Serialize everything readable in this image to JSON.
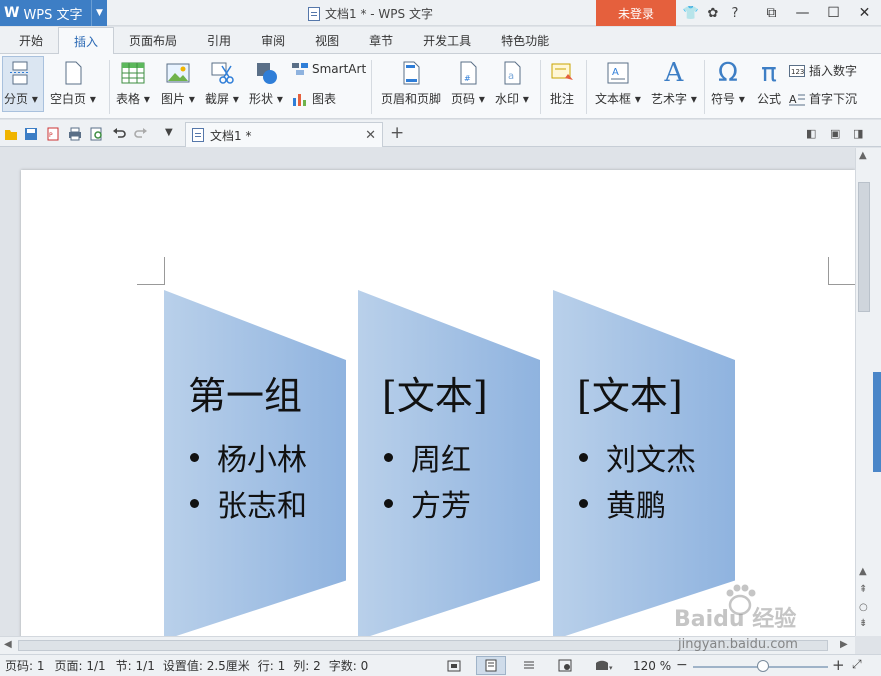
{
  "app": {
    "name": "WPS 文字",
    "window_title": "文档1 * - WPS 文字",
    "login": "未登录"
  },
  "title_icons": [
    "shirt-icon",
    "chat-icon",
    "help-icon"
  ],
  "help_label": "?",
  "tabs": [
    "开始",
    "插入",
    "页面布局",
    "引用",
    "审阅",
    "视图",
    "章节",
    "开发工具",
    "特色功能"
  ],
  "active_tab": "插入",
  "ribbon": {
    "page_break": "分页",
    "blank_page": "空白页",
    "table": "表格",
    "picture": "图片",
    "screenshot": "截屏",
    "shape": "形状",
    "smartart": "SmartArt",
    "chart": "图表",
    "header_footer": "页眉和页脚",
    "page_number": "页码",
    "watermark": "水印",
    "comment": "批注",
    "textbox": "文本框",
    "wordart": "艺术字",
    "symbol": "符号",
    "formula": "公式",
    "insert_number": "插入数字",
    "drop_cap": "首字下沉",
    "symbol_glyph": "Ω",
    "formula_glyph": "π",
    "wordart_glyph": "A"
  },
  "doc_tab": {
    "title": "文档1 *"
  },
  "document": {
    "groups": [
      {
        "title": "第一组",
        "items": [
          "杨小林",
          "张志和"
        ]
      },
      {
        "title": "[文本]",
        "items": [
          "周红",
          "方芳"
        ]
      },
      {
        "title": "[文本]",
        "items": [
          "刘文杰",
          "黄鹏"
        ]
      }
    ]
  },
  "status": {
    "page_num": "页码: 1",
    "pages": "页面: 1/1",
    "section": "节: 1/1",
    "setting": "设置值: 2.5厘米",
    "row": "行: 1",
    "col": "列: 2",
    "words": "字数: 0",
    "zoom": "120 %",
    "zoom_fraction": 0.52
  },
  "watermark": {
    "brand": "Baidu 经验",
    "url": "jingyan.baidu.com"
  },
  "colors": {
    "accent": "#3d7ec5",
    "login": "#e5603d",
    "shape_light": "#b9d0ea",
    "shape_dark": "#8fb3df"
  }
}
